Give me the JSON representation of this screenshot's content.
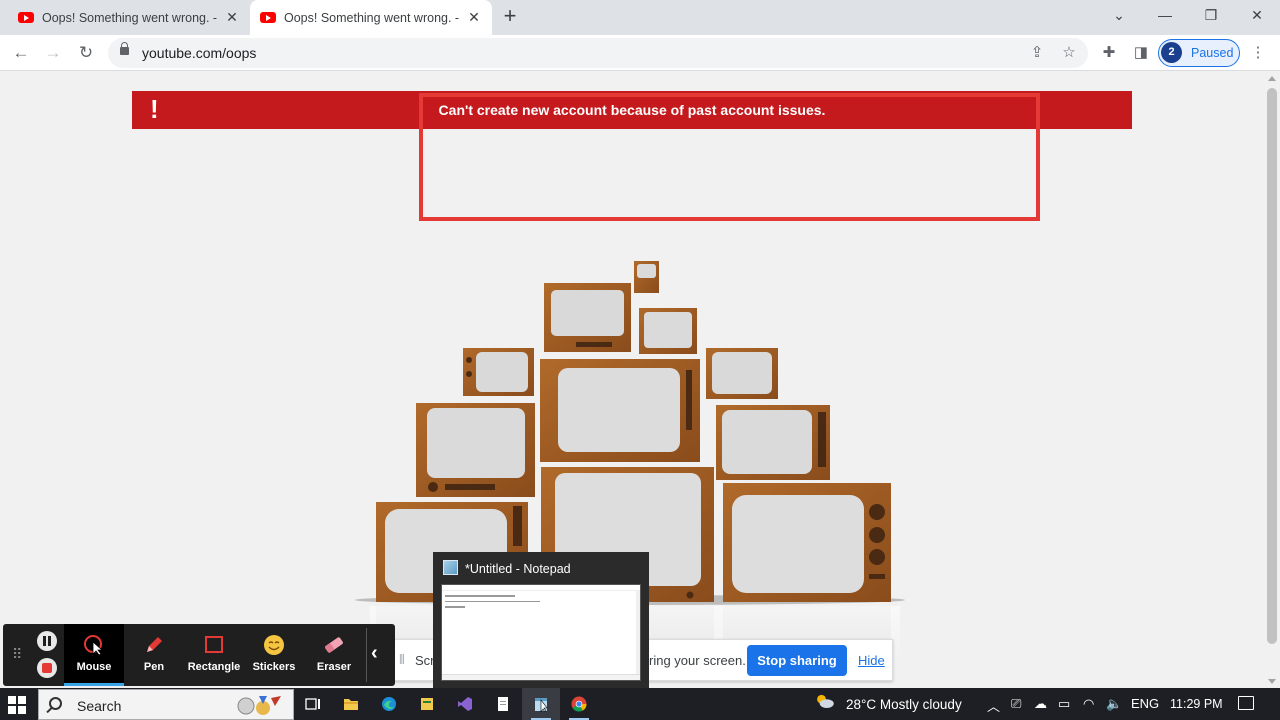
{
  "browser": {
    "tabs": [
      {
        "title": "Oops! Something went wrong. -",
        "active": false
      },
      {
        "title": "Oops! Something went wrong. -",
        "active": true
      }
    ],
    "new_tab_glyph": "+",
    "window_controls": {
      "dropdown": "⌄",
      "minimize": "—",
      "restore": "❐",
      "close": "✕"
    },
    "url": "youtube.com/oops",
    "profile": {
      "initial": "2",
      "status": "Paused"
    }
  },
  "page": {
    "error_icon": "!",
    "error_message": "Can't create new account because of past account issues.",
    "error_color": "#c4191d",
    "highlight_color": "#e53935"
  },
  "annotation_toolbar": {
    "tools": [
      {
        "label": "Mouse",
        "icon": "mouse-cursor-icon",
        "selected": true
      },
      {
        "label": "Pen",
        "icon": "pen-icon",
        "selected": false
      },
      {
        "label": "Rectangle",
        "icon": "rectangle-icon",
        "selected": false
      },
      {
        "label": "Stickers",
        "icon": "sticker-emoji-icon",
        "selected": false
      },
      {
        "label": "Eraser",
        "icon": "eraser-icon",
        "selected": false
      }
    ]
  },
  "share_banner": {
    "text_left": "Scre",
    "text_right": "ring your screen.",
    "stop_label": "Stop sharing",
    "hide_label": "Hide"
  },
  "taskbar_preview": {
    "title": "*Untitled - Notepad"
  },
  "taskbar": {
    "search_placeholder": "Search",
    "weather": "28°C  Mostly cloudy",
    "language": "ENG",
    "time": "11:29 PM"
  }
}
